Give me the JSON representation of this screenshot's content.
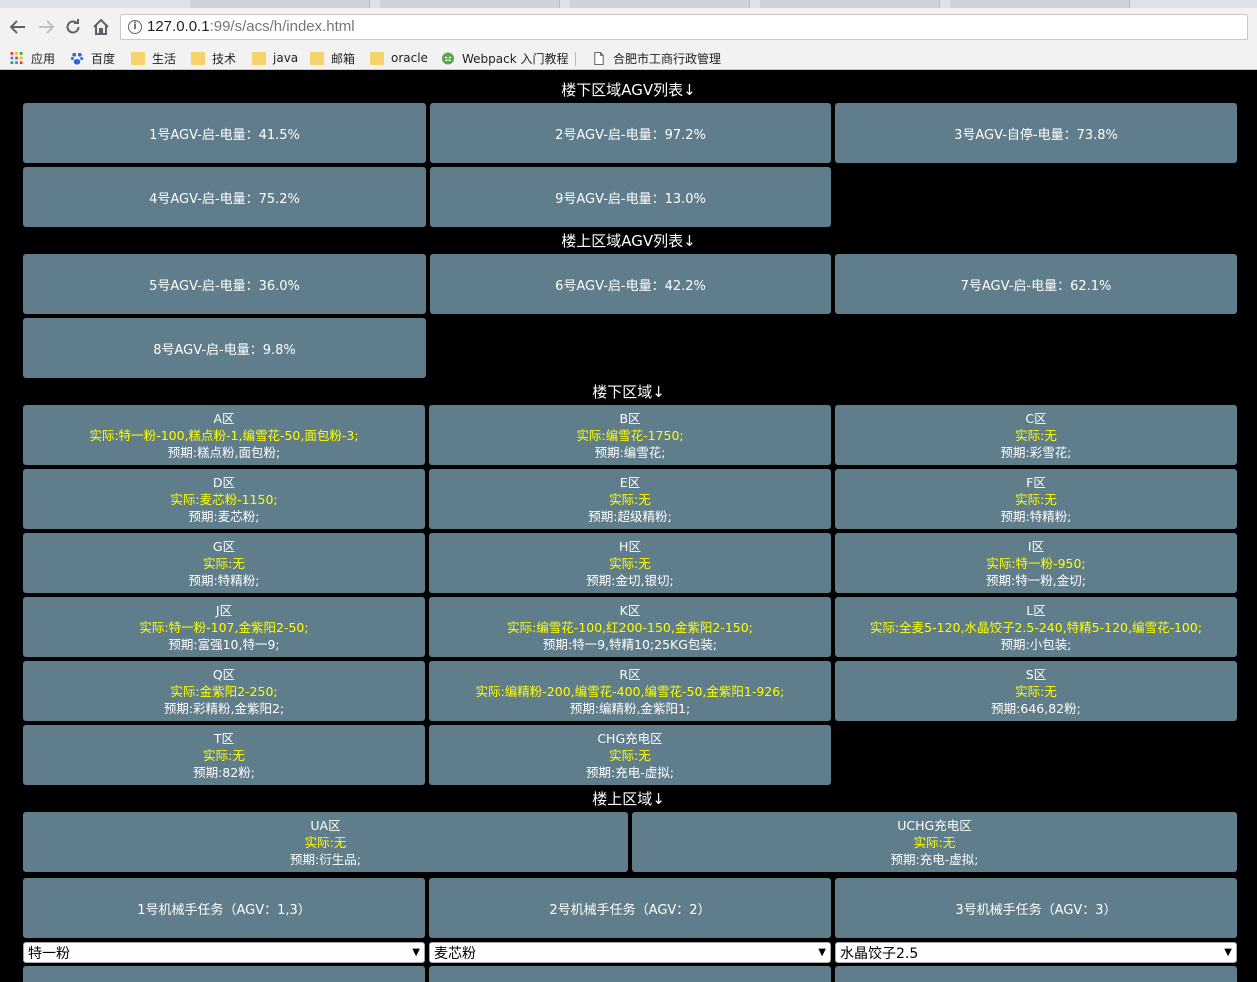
{
  "browser": {
    "url_host": "127.0.0.1",
    "url_rest": ":99/s/acs/h/index.html",
    "bookmarks": [
      "应用",
      "百度",
      "生活",
      "技术",
      "java",
      "邮箱",
      "oracle",
      "Webpack 入门教程",
      "合肥市工商行政管理"
    ]
  },
  "downstairs_agv": {
    "title": "楼下区域AGV列表↓",
    "items": [
      "1号AGV-启-电量：41.5%",
      "2号AGV-启-电量：97.2%",
      "3号AGV-自停-电量：73.8%",
      "4号AGV-启-电量：75.2%",
      "9号AGV-启-电量：13.0%"
    ]
  },
  "upstairs_agv": {
    "title": "楼上区域AGV列表↓",
    "items": [
      "5号AGV-启-电量：36.0%",
      "6号AGV-启-电量：42.2%",
      "7号AGV-启-电量：62.1%",
      "8号AGV-启-电量：9.8%"
    ]
  },
  "downstairs_zones": {
    "title": "楼下区域↓",
    "items": [
      {
        "name": "A区",
        "actual": "实际:特一粉-100,糕点粉-1,编雪花-50,面包粉-3;",
        "expected": "预期:糕点粉,面包粉;"
      },
      {
        "name": "B区",
        "actual": "实际:编雪花-1750;",
        "expected": "预期:编雪花;"
      },
      {
        "name": "C区",
        "actual": "实际:无",
        "expected": "预期:彩雪花;"
      },
      {
        "name": "D区",
        "actual": "实际:麦芯粉-1150;",
        "expected": "预期:麦芯粉;"
      },
      {
        "name": "E区",
        "actual": "实际:无",
        "expected": "预期:超级精粉;"
      },
      {
        "name": "F区",
        "actual": "实际:无",
        "expected": "预期:特精粉;"
      },
      {
        "name": "G区",
        "actual": "实际:无",
        "expected": "预期:特精粉;"
      },
      {
        "name": "H区",
        "actual": "实际:无",
        "expected": "预期:金切,银切;"
      },
      {
        "name": "I区",
        "actual": "实际:特一粉-950;",
        "expected": "预期:特一粉,金切;"
      },
      {
        "name": "J区",
        "actual": "实际:特一粉-107,金紫阳2-50;",
        "expected": "预期:富强10,特一9;"
      },
      {
        "name": "K区",
        "actual": "实际:编雪花-100,红200-150,金紫阳2-150;",
        "expected": "预期:特一9,特精10;25KG包装;"
      },
      {
        "name": "L区",
        "actual": "实际:全麦5-120,水晶饺子2.5-240,特精5-120,编雪花-100;",
        "expected": "预期:小包装;"
      },
      {
        "name": "Q区",
        "actual": "实际:金紫阳2-250;",
        "expected": "预期:彩精粉,金紫阳2;"
      },
      {
        "name": "R区",
        "actual": "实际:编精粉-200,编雪花-400,编雪花-50,金紫阳1-926;",
        "expected": "预期:编精粉,金紫阳1;"
      },
      {
        "name": "S区",
        "actual": "实际:无",
        "expected": "预期:646,82粉;"
      },
      {
        "name": "T区",
        "actual": "实际:无",
        "expected": "预期:82粉;"
      },
      {
        "name": "CHG充电区",
        "actual": "实际:无",
        "expected": "预期:充电-虚拟;"
      }
    ]
  },
  "upstairs_zones": {
    "title": "楼上区域↓",
    "items": [
      {
        "name": "UA区",
        "actual": "实际:无",
        "expected": "预期:衍生品;"
      },
      {
        "name": "UCHG充电区",
        "actual": "实际:无",
        "expected": "预期:充电-虚拟;"
      }
    ]
  },
  "robot_tasks": {
    "items": [
      "1号机械手任务（AGV：1,3）",
      "2号机械手任务（AGV：2）",
      "3号机械手任务（AGV：3）"
    ],
    "selects": [
      "特一粉",
      "麦芯粉",
      "水晶饺子2.5"
    ]
  }
}
